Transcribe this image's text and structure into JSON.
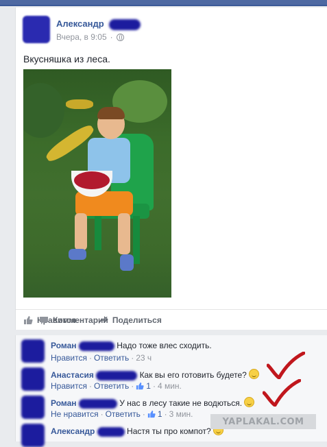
{
  "post": {
    "author": "Александр",
    "timestamp": "Вчера, в 9:05",
    "privacy_icon": "globe-icon",
    "text": "Вкусняшка из леса."
  },
  "actions": {
    "like_label": "Нравится",
    "comment_label": "Комментарий",
    "share_label": "Поделиться"
  },
  "comments": [
    {
      "name": "Роман",
      "text": "Надо тоже влес сходить.",
      "like_label": "Нравится",
      "reply_label": "Ответить",
      "time": "23 ч"
    },
    {
      "name": "Анастасия",
      "text": "Как вы его готовить будете?",
      "like_label": "Нравится",
      "reply_label": "Ответить",
      "likes": "1",
      "time": "4 мин."
    },
    {
      "name": "Роман",
      "text": "У нас в лесу такие не водються.",
      "like_label": "Не нравится",
      "reply_label": "Ответить",
      "likes": "1",
      "time": "3 мин."
    },
    {
      "name": "Александр",
      "text": "Настя ты про компот?"
    }
  ],
  "watermark": "YAPLAKAL.COM",
  "colors": {
    "link": "#365899",
    "meta": "#90949c",
    "checkmark": "#c0171d"
  }
}
